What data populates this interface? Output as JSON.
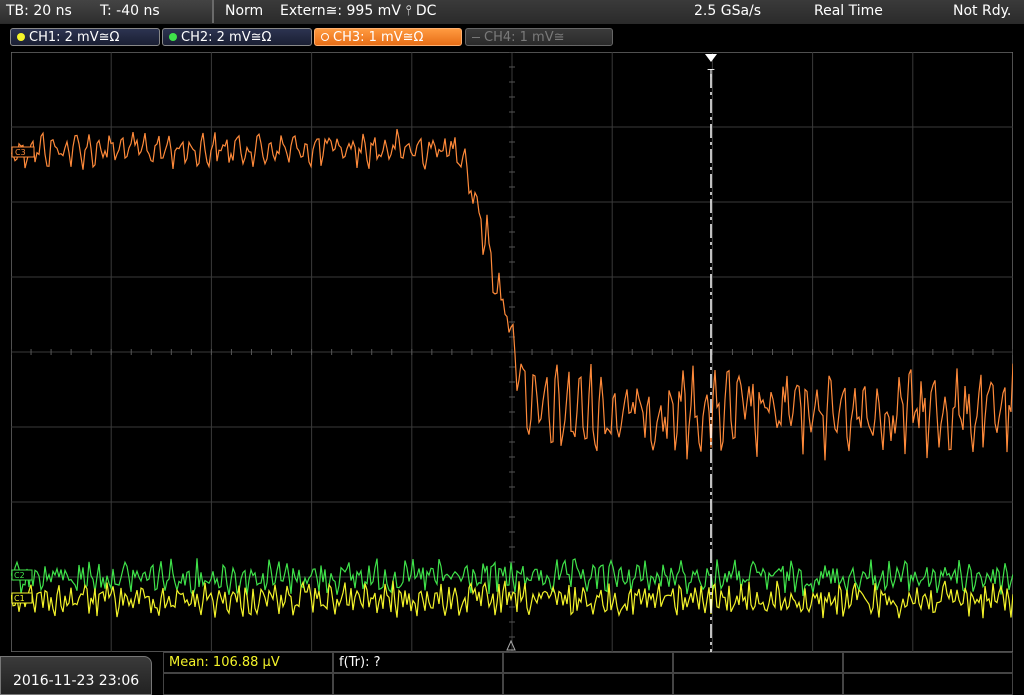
{
  "top": {
    "timebase": "TB: 20 ns",
    "trigger_time": "T: -40 ns",
    "mode": "Norm",
    "trigger_source": "Extern≅: 995 mV ⫯ DC",
    "sample_rate": "2.5 GSa/s",
    "acq_mode": "Real Time",
    "status": "Not Rdy."
  },
  "channels": [
    {
      "label": "CH1: 2 mV≅Ω",
      "color": "#f3f32a",
      "state": "on"
    },
    {
      "label": "CH2: 2 mV≅Ω",
      "color": "#3fe24a",
      "state": "on"
    },
    {
      "label": "CH3: 1 mV≅Ω",
      "color": "#ff8a3a",
      "state": "active"
    },
    {
      "label": "CH4: 1 mV≅",
      "color": "#888888",
      "state": "off"
    }
  ],
  "markers": {
    "ch3": "C3",
    "ch2": "C2",
    "ch1": "C1",
    "trigger": "T"
  },
  "bottom": {
    "datetime": "2016-11-23 23:06",
    "meas1": "Mean: 106.88 µV",
    "meas2": "f(Tr): ?"
  },
  "colors": {
    "ch1": "#f3f32a",
    "ch2": "#3fe24a",
    "ch3": "#ff8a3a",
    "grid": "#3a3a3a",
    "meas_yellow": "#f3f32a"
  },
  "waveform_description": {
    "ch3_high_level_div": 2.7,
    "ch3_low_level_div": -0.8,
    "ch3_edge_time_div": 4.6,
    "ch1_level_div": -3.3,
    "ch2_level_div": -3.0
  }
}
